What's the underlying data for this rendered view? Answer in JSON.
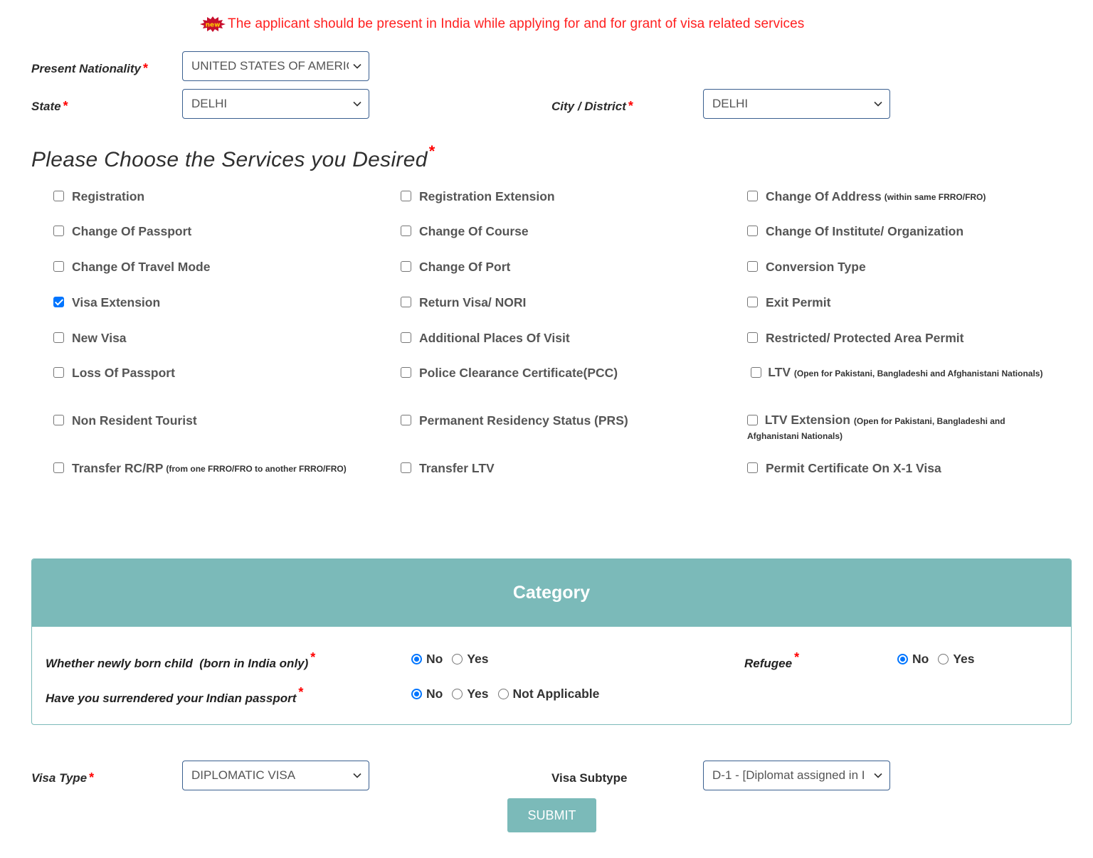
{
  "notice": {
    "badge_icon": "new-burst-icon",
    "badge_text": "new",
    "text": "The applicant should be present in India while applying for and for grant of visa related services"
  },
  "fields": {
    "nationality": {
      "label": "Present Nationality",
      "required": "*",
      "value": "UNITED STATES OF AMERICA"
    },
    "state": {
      "label": "State",
      "required": "*",
      "value": "DELHI"
    },
    "city": {
      "label": "City / District",
      "required": "*",
      "value": "DELHI"
    }
  },
  "services": {
    "heading": "Please Choose the Services you Desired",
    "required": "*",
    "items": [
      {
        "label": "Registration",
        "note": "",
        "checked": false
      },
      {
        "label": "Registration Extension",
        "note": "",
        "checked": false
      },
      {
        "label": "Change Of Address",
        "note": "(within same FRRO/FRO)",
        "checked": false
      },
      {
        "label": "Change Of Passport",
        "note": "",
        "checked": false
      },
      {
        "label": "Change Of Course",
        "note": "",
        "checked": false
      },
      {
        "label": "Change Of Institute/ Organization",
        "note": "",
        "checked": false
      },
      {
        "label": "Change Of Travel Mode",
        "note": "",
        "checked": false
      },
      {
        "label": "Change Of Port",
        "note": "",
        "checked": false
      },
      {
        "label": "Conversion Type",
        "note": "",
        "checked": false
      },
      {
        "label": "Visa Extension",
        "note": "",
        "checked": true
      },
      {
        "label": "Return Visa/ NORI",
        "note": "",
        "checked": false
      },
      {
        "label": "Exit Permit",
        "note": "",
        "checked": false
      },
      {
        "label": "New Visa",
        "note": "",
        "checked": false
      },
      {
        "label": "Additional Places Of Visit",
        "note": "",
        "checked": false
      },
      {
        "label": "Restricted/ Protected Area Permit",
        "note": "",
        "checked": false
      },
      {
        "label": "Loss Of Passport",
        "note": "",
        "checked": false
      },
      {
        "label": "Police Clearance Certificate(PCC)",
        "note": "",
        "checked": false
      },
      {
        "label": "LTV",
        "note": "(Open for Pakistani, Bangladeshi and Afghanistani Nationals)",
        "checked": false
      },
      {
        "label": "Non Resident Tourist",
        "note": "",
        "checked": false
      },
      {
        "label": "Permanent Residency Status (PRS)",
        "note": "",
        "checked": false
      },
      {
        "label": "LTV Extension",
        "note": "(Open for Pakistani, Bangladeshi and Afghanistani Nationals)",
        "checked": false
      },
      {
        "label": "Transfer RC/RP",
        "note": "(from one FRRO/FRO to another FRRO/FRO)",
        "checked": false
      },
      {
        "label": "Transfer LTV",
        "note": "",
        "checked": false
      },
      {
        "label": "Permit Certificate On X-1 Visa",
        "note": "",
        "checked": false
      }
    ]
  },
  "category": {
    "title": "Category",
    "questions": {
      "newborn": {
        "label": "Whether newly born child  (born in India only)",
        "required": "*",
        "options": [
          "No",
          "Yes"
        ],
        "selected": "No"
      },
      "surrendered": {
        "label": "Have you surrendered your Indian passport",
        "required": "*",
        "options": [
          "No",
          "Yes",
          "Not Applicable"
        ],
        "selected": "No"
      },
      "refugee": {
        "label": "Refugee",
        "required": "*",
        "options": [
          "No",
          "Yes"
        ],
        "selected": "No"
      }
    }
  },
  "visa": {
    "type": {
      "label": "Visa Type",
      "required": "*",
      "value": "DIPLOMATIC VISA"
    },
    "subtype": {
      "label": "Visa Subtype",
      "value": "D-1 - [Diplomat assigned in I"
    }
  },
  "submit_label": "SUBMIT",
  "colors": {
    "accent": "#7bbab9",
    "notice": "#ff1f1f",
    "checkbox": "#0075ff",
    "required": "#ff0000"
  }
}
